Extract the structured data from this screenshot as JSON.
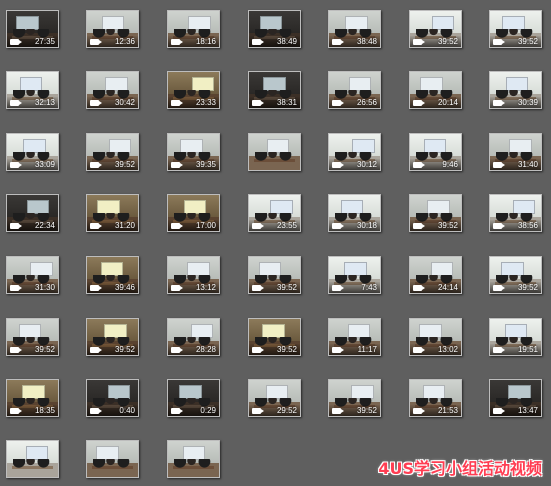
{
  "caption": "4US学习小组活动视频",
  "colors": {
    "background": "#5f5f5f",
    "caption": "#ff3d52",
    "duration_text": "#ffffff"
  },
  "icons": {
    "video": "video-camera-icon"
  },
  "rows": [
    [
      {
        "duration": "27:35",
        "tone": "dark"
      },
      {
        "duration": "12:36",
        "tone": "office"
      },
      {
        "duration": "18:16",
        "tone": "office"
      },
      {
        "duration": "38:49",
        "tone": "dark"
      },
      {
        "duration": "38:48",
        "tone": "office"
      },
      {
        "duration": "39:52",
        "tone": "bright"
      },
      {
        "duration": "39:52",
        "tone": "bright"
      }
    ],
    [
      {
        "duration": "32:13",
        "tone": "bright"
      },
      {
        "duration": "30:42",
        "tone": "office"
      },
      {
        "duration": "23:33",
        "tone": "warm"
      },
      {
        "duration": "38:31",
        "tone": "dark"
      },
      {
        "duration": "26:56",
        "tone": "office"
      },
      {
        "duration": "20:14",
        "tone": "office"
      },
      {
        "duration": "30:39",
        "tone": "bright"
      }
    ],
    [
      {
        "duration": "33:09",
        "tone": "bright"
      },
      {
        "duration": "39:52",
        "tone": "office"
      },
      {
        "duration": "39:35",
        "tone": "office"
      },
      {
        "duration": "",
        "tone": "office"
      },
      {
        "duration": "30:12",
        "tone": "bright"
      },
      {
        "duration": "9:46",
        "tone": "bright"
      },
      {
        "duration": "31:40",
        "tone": "office"
      }
    ],
    [
      {
        "duration": "22:34",
        "tone": "dark"
      },
      {
        "duration": "31:20",
        "tone": "warm"
      },
      {
        "duration": "17:00",
        "tone": "warm"
      },
      {
        "duration": "23:55",
        "tone": "bright"
      },
      {
        "duration": "30:18",
        "tone": "bright"
      },
      {
        "duration": "39:52",
        "tone": "office"
      },
      {
        "duration": "38:56",
        "tone": "bright"
      }
    ],
    [
      {
        "duration": "31:30",
        "tone": "office"
      },
      {
        "duration": "39:46",
        "tone": "warm"
      },
      {
        "duration": "13:12",
        "tone": "office"
      },
      {
        "duration": "39:52",
        "tone": "office"
      },
      {
        "duration": "7:43",
        "tone": "bright"
      },
      {
        "duration": "24:14",
        "tone": "office"
      },
      {
        "duration": "39:52",
        "tone": "bright"
      }
    ],
    [
      {
        "duration": "39:52",
        "tone": "office"
      },
      {
        "duration": "39:52",
        "tone": "warm"
      },
      {
        "duration": "28:28",
        "tone": "office"
      },
      {
        "duration": "39:52",
        "tone": "warm"
      },
      {
        "duration": "11:17",
        "tone": "office"
      },
      {
        "duration": "13:02",
        "tone": "office"
      },
      {
        "duration": "19:51",
        "tone": "bright"
      }
    ],
    [
      {
        "duration": "18:35",
        "tone": "warm"
      },
      {
        "duration": "0:40",
        "tone": "dark"
      },
      {
        "duration": "0:29",
        "tone": "dark"
      },
      {
        "duration": "29:52",
        "tone": "office"
      },
      {
        "duration": "39:52",
        "tone": "office"
      },
      {
        "duration": "21:53",
        "tone": "office"
      },
      {
        "duration": "13:47",
        "tone": "dark"
      }
    ],
    [
      {
        "duration": "",
        "tone": "bright"
      },
      {
        "duration": "",
        "tone": "office"
      },
      {
        "duration": "",
        "tone": "office"
      }
    ]
  ]
}
